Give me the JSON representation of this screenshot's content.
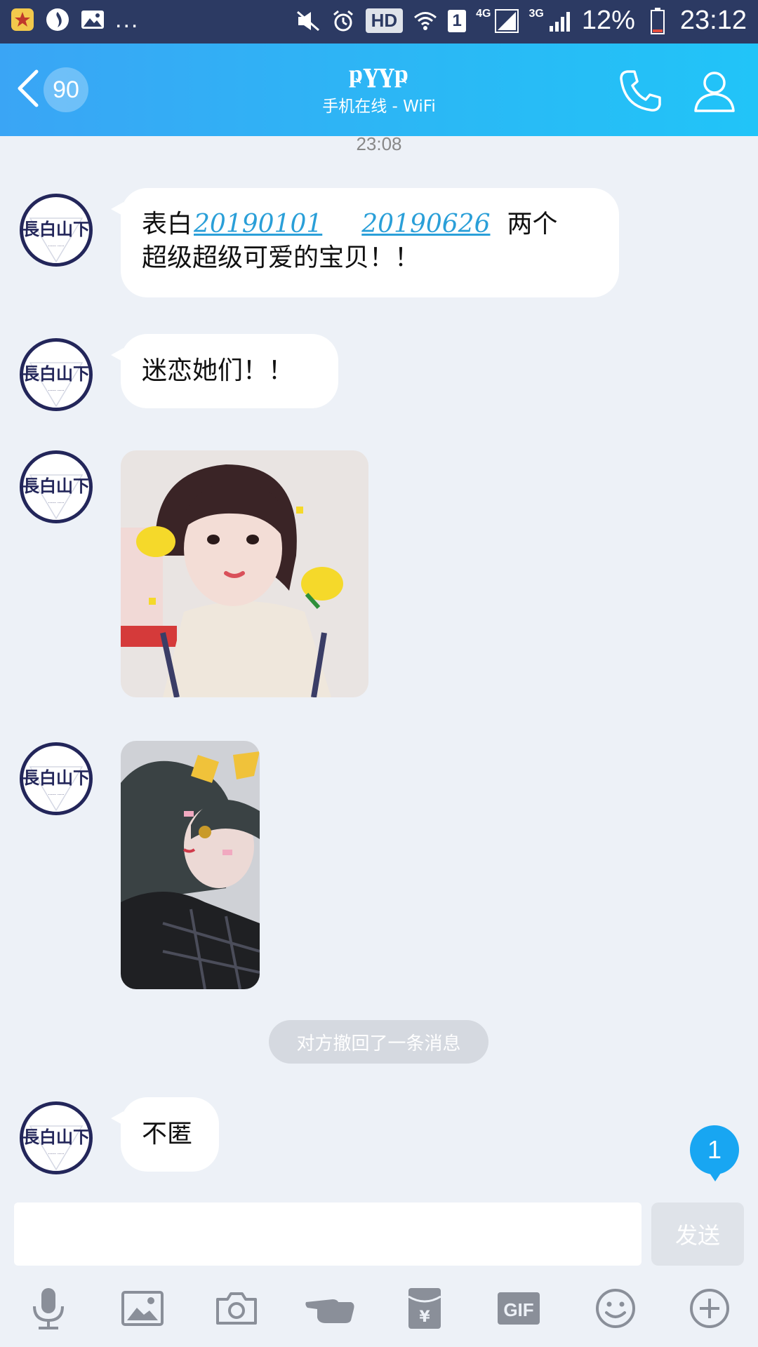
{
  "status_bar": {
    "dots": "...",
    "hd": "HD",
    "sim": "1",
    "net1": "4G",
    "net2": "3G",
    "battery": "12%",
    "time": "23:12"
  },
  "header": {
    "unread": "90",
    "name": "ҏүүҏ",
    "status": "手机在线 - WiFi"
  },
  "chat": {
    "timestamp": "23:08",
    "msg1": {
      "pre": "表白",
      "link1": "20190101",
      "link2": "20190626",
      "post": "两个",
      "line2": "超级超级可爱的宝贝！！"
    },
    "msg2": "迷恋她们！！",
    "recall": "对方撤回了一条消息",
    "msg3": "不匿",
    "new_badge": "1"
  },
  "input": {
    "value": "",
    "placeholder": "",
    "send": "发送"
  },
  "toolbar": {
    "gif": "GIF"
  },
  "colors": {
    "header_start": "#3aa5f5",
    "header_end": "#21c4f8",
    "status_bar": "#2c3a63",
    "link": "#2a9fd8",
    "badge": "#18a6f2"
  }
}
